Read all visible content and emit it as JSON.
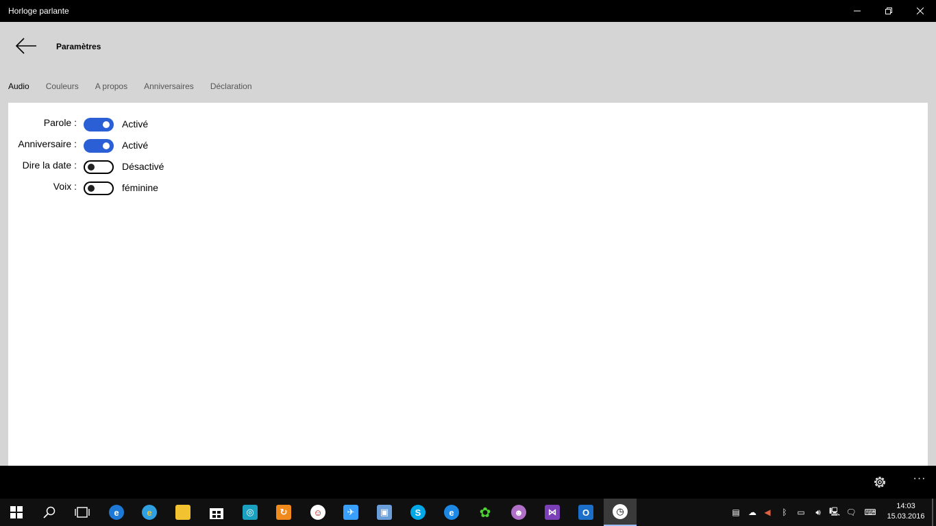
{
  "window": {
    "title": "Horloge parlante"
  },
  "header": {
    "title": "Paramètres",
    "tabs": [
      {
        "label": "Audio",
        "active": true
      },
      {
        "label": "Couleurs",
        "active": false
      },
      {
        "label": "A propos",
        "active": false
      },
      {
        "label": "Anniversaires",
        "active": false
      },
      {
        "label": "Déclaration",
        "active": false
      }
    ]
  },
  "settings": [
    {
      "label": "Parole :",
      "state": "Activé",
      "on": true
    },
    {
      "label": "Anniversaire :",
      "state": "Activé",
      "on": true
    },
    {
      "label": "Dire la date :",
      "state": "Désactivé",
      "on": false
    },
    {
      "label": "Voix :",
      "state": "féminine",
      "on": false
    }
  ],
  "appbar": {
    "more": "···"
  },
  "taskbar": {
    "apps": [
      {
        "name": "start-icon"
      },
      {
        "name": "search-icon"
      },
      {
        "name": "task-view-icon"
      },
      {
        "name": "edge-icon",
        "color": "#1e78d6"
      },
      {
        "name": "internet-explorer-icon",
        "color": "#2fa0e0"
      },
      {
        "name": "file-explorer-icon",
        "color": "#f2c230"
      },
      {
        "name": "store-icon",
        "color": "#ffffff"
      },
      {
        "name": "app-cyan-icon",
        "color": "#1aa0c0"
      },
      {
        "name": "app-orange-icon",
        "color": "#f08a1c"
      },
      {
        "name": "clock-face-app-icon",
        "color": "#ffffff"
      },
      {
        "name": "plane-app-icon",
        "color": "#3aa0ff"
      },
      {
        "name": "photos-app-icon",
        "color": "#6a9ed8"
      },
      {
        "name": "skype-icon",
        "color": "#00a8e8"
      },
      {
        "name": "edge-dark-icon",
        "color": "#1e88e5"
      },
      {
        "name": "icq-flower-icon",
        "color": "#4cd232"
      },
      {
        "name": "messenger-icon",
        "color": "#b070c8"
      },
      {
        "name": "visual-studio-icon",
        "color": "#7b3fb8"
      },
      {
        "name": "outlook-icon",
        "color": "#1b6fc8"
      },
      {
        "name": "talking-clock-icon",
        "color": "#ffffff"
      }
    ],
    "clock": {
      "time": "14:03",
      "date": "15.03.2016"
    }
  }
}
